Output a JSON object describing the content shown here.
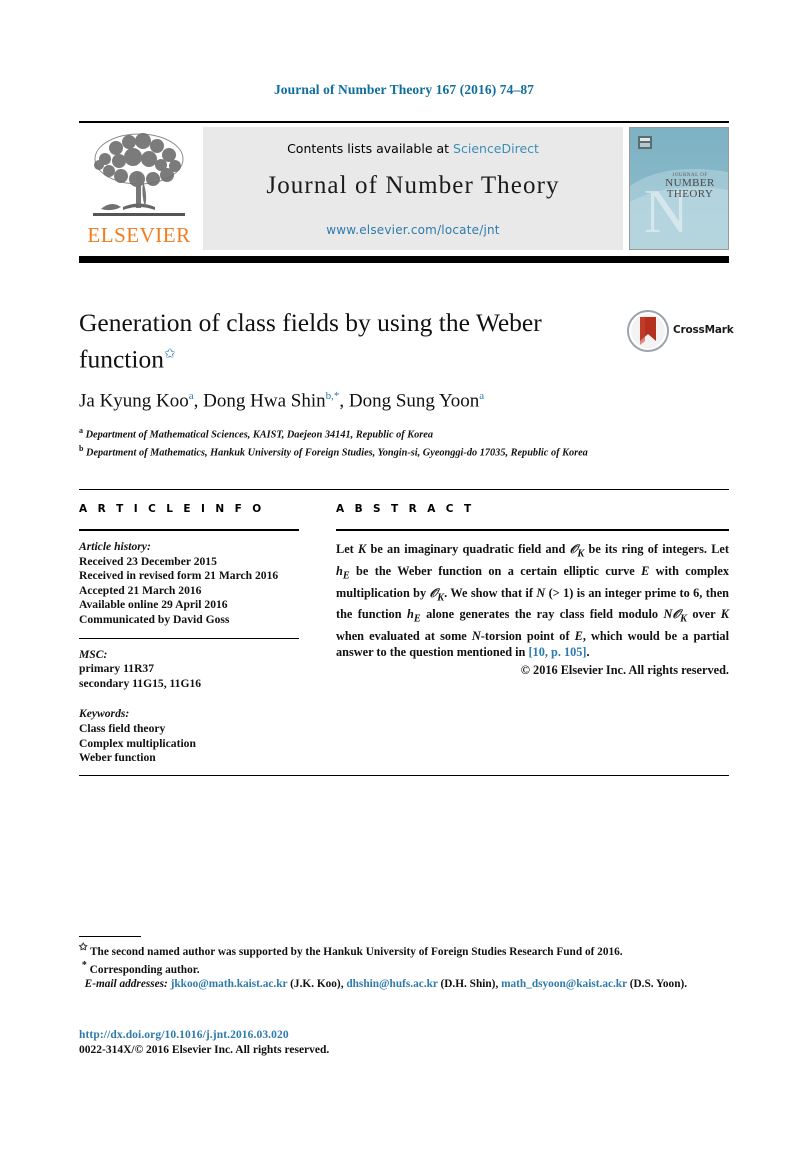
{
  "running_head": "Journal of Number Theory 167 (2016) 74–87",
  "banner": {
    "publisher_wordmark": "ELSEVIER",
    "contents_prefix": "Contents lists available at",
    "sciencedirect": "ScienceDirect",
    "journal_title": "Journal of Number Theory",
    "journal_url": "www.elsevier.com/locate/jnt",
    "cover": {
      "line1": "JOURNAL OF",
      "line2": "NUMBER",
      "line3": "THEORY",
      "watermark": "N",
      "bg_color": "#7fb3c4",
      "accent_color": "#dce9ee"
    }
  },
  "article": {
    "title": "Generation of class fields by using the Weber function",
    "title_footnote_mark": "✩",
    "authors": [
      {
        "name": "Ja Kyung Koo",
        "marks": "a"
      },
      {
        "name": "Dong Hwa Shin",
        "marks": "b,*"
      },
      {
        "name": "Dong Sung Yoon",
        "marks": "a"
      }
    ],
    "affiliations": [
      {
        "mark": "a",
        "text": "Department of Mathematical Sciences, KAIST, Daejeon 34141, Republic of Korea"
      },
      {
        "mark": "b",
        "text": "Department of Mathematics, Hankuk University of Foreign Studies, Yongin-si, Gyeonggi-do 17035, Republic of Korea"
      }
    ]
  },
  "info": {
    "heading": "A R T I C L E   I N F O",
    "history_label": "Article history:",
    "history": [
      "Received 23 December 2015",
      "Received in revised form 21 March 2016",
      "Accepted 21 March 2016",
      "Available online 29 April 2016",
      "Communicated by David Goss"
    ],
    "msc_label": "MSC:",
    "msc": [
      "primary 11R37",
      "secondary 11G15, 11G16"
    ],
    "keywords_label": "Keywords:",
    "keywords": [
      "Class field theory",
      "Complex multiplication",
      "Weber function"
    ]
  },
  "abstract": {
    "heading": "A B S T R A C T",
    "text_part1": "Let ",
    "K1": "K",
    "text_part2": " be an imaginary quadratic field and ",
    "OK1": "𝒪",
    "OK1sub": "K",
    "text_part3": " be its ring of integers. Let ",
    "h1": "h",
    "h1sub": "E",
    "text_part4": " be the Weber function on a certain elliptic curve ",
    "E1": "E",
    "text_part5": " with complex multiplication by ",
    "OK2": "𝒪",
    "OK2sub": "K",
    "text_part6": ". We show that if ",
    "N1": "N",
    "text_part7": " (> 1) is an integer prime to 6, then the function ",
    "h2": "h",
    "h2sub": "E",
    "text_part8": " alone generates the ray class field modulo ",
    "N2": "N",
    "OK3": "𝒪",
    "OK3sub": "K",
    "text_part9": " over ",
    "K2": "K",
    "text_part10": " when evaluated at some ",
    "N3": "N",
    "text_part11": "-torsion point of ",
    "E2": "E",
    "text_part12": ", which would be a partial answer to the question mentioned in ",
    "citation": "[10, p. 105]",
    "text_part13": ".",
    "copyright": "© 2016 Elsevier Inc. All rights reserved."
  },
  "footnotes": {
    "funding_mark": "✩",
    "funding": "The second named author was supported by the Hankuk University of Foreign Studies Research Fund of 2016.",
    "corresponding_mark": "*",
    "corresponding": "Corresponding author.",
    "email_label": "E-mail addresses:",
    "emails": [
      {
        "address": "jkkoo@math.kaist.ac.kr",
        "owner": "(J.K. Koo)"
      },
      {
        "address": "dhshin@hufs.ac.kr",
        "owner": "(D.H. Shin)"
      },
      {
        "address": "math_dsyoon@kaist.ac.kr",
        "owner": "(D.S. Yoon)"
      }
    ]
  },
  "doi": "http://dx.doi.org/10.1016/j.jnt.2016.03.020",
  "issn_line": "0022-314X/© 2016 Elsevier Inc. All rights reserved.",
  "crossmark": {
    "label": "CrossMark",
    "color": "#b5301f"
  }
}
